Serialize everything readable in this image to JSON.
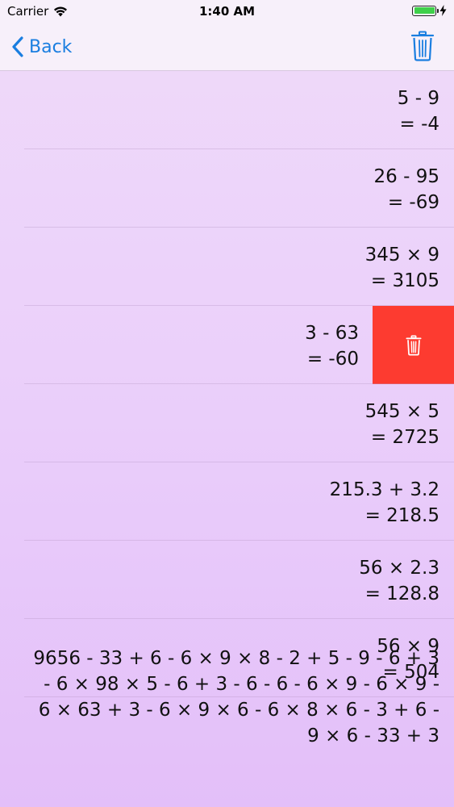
{
  "status_bar": {
    "carrier": "Carrier",
    "time": "1:40 AM"
  },
  "nav": {
    "back_label": "Back",
    "back_icon": "chevron-left-icon",
    "trash_icon": "trash-icon",
    "accent_color": "#1a7ee0"
  },
  "history": [
    {
      "expression": "5 - 9",
      "result": "= -4"
    },
    {
      "expression": "26 - 95",
      "result": "= -69"
    },
    {
      "expression": "345 × 9",
      "result": "= 3105"
    },
    {
      "expression": "3 - 63",
      "result": "= -60"
    },
    {
      "expression": "545 × 5",
      "result": "= 2725"
    },
    {
      "expression": "215.3 + 3.2",
      "result": "= 218.5"
    },
    {
      "expression": "56 × 2.3",
      "result": "= 128.8"
    },
    {
      "expression": "56 × 9",
      "result": "= 504"
    }
  ],
  "long_entry": {
    "lines": [
      "9656 - 33 + 6 - 6 × 9 × 8 - 2 + 5 - 9 - 6 + 3",
      "- 6 × 98 × 5 - 6 + 3 - 6 - 6 - 6 × 9 - 6 × 9 -",
      "6 × 63 + 3 - 6 × 9 × 6 - 6 × 8 × 6 - 3 + 6 -",
      "9 × 6 - 33 + 3"
    ]
  },
  "swipe_delete": {
    "row_index": 3,
    "color": "#fd3b30",
    "icon": "trash-icon"
  }
}
